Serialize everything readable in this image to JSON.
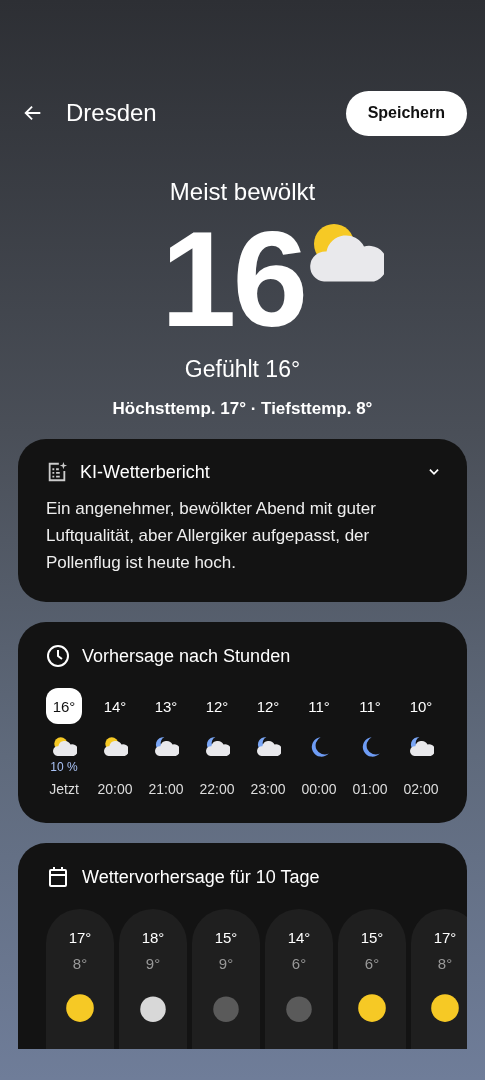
{
  "header": {
    "city": "Dresden",
    "save_button": "Speichern"
  },
  "current": {
    "condition": "Meist bewölkt",
    "temperature": "16",
    "kind": "partly_sunny",
    "feels_like": "Gefühlt 16°",
    "high_low": "Höchsttemp. 17° · Tiefsttemp. 8°"
  },
  "ai_report": {
    "title": "KI-Wetterbericht",
    "expanded": true,
    "text": "Ein angenehmer, bewölkter Abend mit guter Luftqualität, aber Allergiker aufgepasst, der Pollenflug ist heute hoch."
  },
  "hourly": {
    "title": "Vorhersage nach Stunden",
    "items": [
      {
        "temp": "16°",
        "kind": "partly_sunny",
        "precip": "10 %",
        "time": "Jetzt",
        "selected": true
      },
      {
        "temp": "14°",
        "kind": "partly_sunny",
        "time": "20:00",
        "selected": false
      },
      {
        "temp": "13°",
        "kind": "partly_moon",
        "time": "21:00",
        "selected": false
      },
      {
        "temp": "12°",
        "kind": "partly_moon",
        "time": "22:00",
        "selected": false
      },
      {
        "temp": "12°",
        "kind": "partly_moon",
        "time": "23:00",
        "selected": false
      },
      {
        "temp": "11°",
        "kind": "moon",
        "time": "00:00",
        "selected": false
      },
      {
        "temp": "11°",
        "kind": "moon",
        "time": "01:00",
        "selected": false
      },
      {
        "temp": "10°",
        "kind": "partly_moon",
        "time": "02:00",
        "selected": false
      }
    ]
  },
  "daily": {
    "title": "Wettervorhersage für 10 Tage",
    "items": [
      {
        "high": "17°",
        "low": "8°",
        "kind": "sunny"
      },
      {
        "high": "18°",
        "low": "9°",
        "kind": "cloudy"
      },
      {
        "high": "15°",
        "low": "9°",
        "kind": "dark_cloud"
      },
      {
        "high": "14°",
        "low": "6°",
        "kind": "dark_cloud"
      },
      {
        "high": "15°",
        "low": "6°",
        "kind": "sunny"
      },
      {
        "high": "17°",
        "low": "8°",
        "kind": "sunny"
      }
    ]
  }
}
